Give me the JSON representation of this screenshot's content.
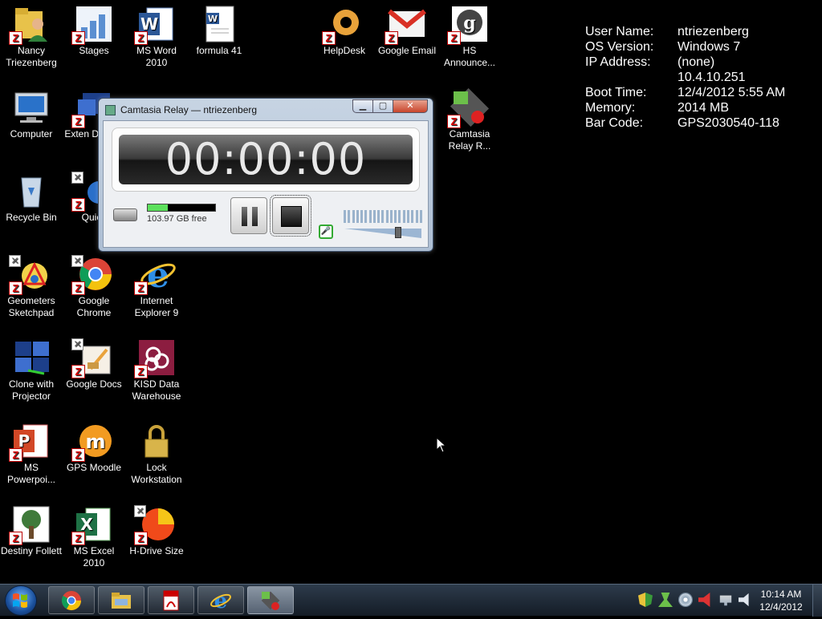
{
  "desktop_icons": [
    {
      "label": "Nancy Triezenberg",
      "icon": "user-folder-icon"
    },
    {
      "label": "Stages",
      "icon": "stages-icon"
    },
    {
      "label": "MS Word 2010",
      "icon": "word-icon"
    },
    {
      "label": "formula 41",
      "icon": "word-document-icon"
    },
    {
      "label": "HelpDesk",
      "icon": "lifebuoy-icon"
    },
    {
      "label": "Google Email",
      "icon": "gmail-icon"
    },
    {
      "label": "HS Announce...",
      "icon": "hs-announce-icon"
    },
    {
      "label": "Computer",
      "icon": "computer-icon"
    },
    {
      "label": "Exten Display",
      "icon": "extended-display-icon"
    },
    {
      "label": "Camtasia Relay R...",
      "icon": "camtasia-relay-icon"
    },
    {
      "label": "Recycle Bin",
      "icon": "recycle-bin-icon"
    },
    {
      "label": "Quick",
      "icon": "quick-icon"
    },
    {
      "label": "Geometers Sketchpad",
      "icon": "sketchpad-icon"
    },
    {
      "label": "Google Chrome",
      "icon": "chrome-icon"
    },
    {
      "label": "Internet Explorer 9",
      "icon": "internet-explorer-icon"
    },
    {
      "label": "Clone with Projector",
      "icon": "clone-projector-icon"
    },
    {
      "label": "Google Docs",
      "icon": "google-docs-icon"
    },
    {
      "label": "KISD Data Warehouse",
      "icon": "data-warehouse-icon"
    },
    {
      "label": "MS Powerpoi...",
      "icon": "powerpoint-icon"
    },
    {
      "label": "GPS Moodle",
      "icon": "moodle-icon"
    },
    {
      "label": "Lock Workstation",
      "icon": "lock-icon"
    },
    {
      "label": "Destiny Follett",
      "icon": "destiny-tree-icon"
    },
    {
      "label": "MS Excel 2010",
      "icon": "excel-icon"
    },
    {
      "label": "H-Drive Size",
      "icon": "pie-chart-icon"
    }
  ],
  "info": {
    "user_name_label": "User Name:",
    "user_name": "ntriezenberg",
    "os_label": "OS Version:",
    "os": "Windows 7",
    "ip_label": "IP Address:",
    "ip1": "(none)",
    "ip2": "10.4.10.251",
    "boot_label": "Boot Time:",
    "boot": "12/4/2012 5:55 AM",
    "memory_label": "Memory:",
    "memory": "2014 MB",
    "barcode_label": "Bar Code:",
    "barcode": "GPS2030540-118"
  },
  "camtasia": {
    "title": "Camtasia Relay — ntriezenberg",
    "timer": "00:00:00",
    "disk_free": "103.97 GB free",
    "disk_fill_fraction": 0.3,
    "volume_level": 0.72,
    "minimize_glyph": "▁",
    "maximize_glyph": "▢",
    "close_glyph": "✕",
    "mic_glyph": "🎤"
  },
  "taskbar": {
    "time": "10:14 AM",
    "date": "12/4/2012",
    "pinned": [
      "chrome-icon",
      "explorer-folder-icon",
      "acrobat-icon",
      "internet-explorer-icon",
      "camtasia-relay-icon"
    ]
  }
}
